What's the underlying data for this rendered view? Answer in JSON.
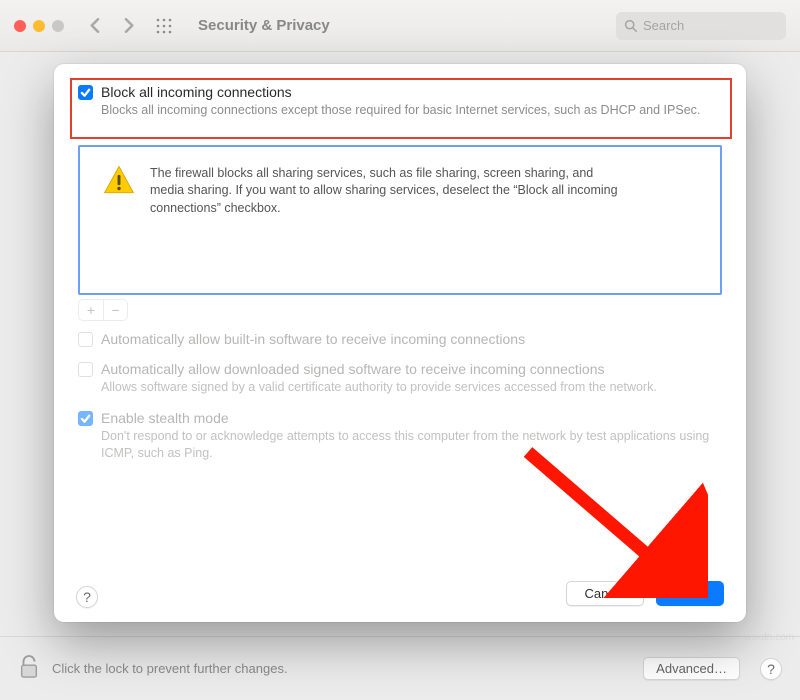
{
  "toolbar": {
    "title": "Security & Privacy",
    "search_placeholder": "Search"
  },
  "sheet": {
    "block_all": {
      "checked": true,
      "label": "Block all incoming connections",
      "desc": "Blocks all incoming connections except those required for basic Internet services, such as DHCP and IPSec."
    },
    "warning": "The firewall blocks all sharing services, such as file sharing, screen sharing, and media sharing. If you want to allow sharing services, deselect the “Block all incoming connections” checkbox.",
    "add_button": "+",
    "remove_button": "−",
    "auto_builtin": {
      "checked": false,
      "label": "Automatically allow built-in software to receive incoming connections"
    },
    "auto_signed": {
      "checked": false,
      "label": "Automatically allow downloaded signed software to receive incoming connections",
      "desc": "Allows software signed by a valid certificate authority to provide services accessed from the network."
    },
    "stealth": {
      "checked": true,
      "label": "Enable stealth mode",
      "desc": "Don't respond to or acknowledge attempts to access this computer from the network by test applications using ICMP, such as Ping."
    },
    "help": "?",
    "cancel": "Cancel",
    "ok": "OK"
  },
  "footer": {
    "lock_text": "Click the lock to prevent further changes.",
    "advanced": "Advanced…",
    "help": "?"
  },
  "watermark": "wsxdn.com"
}
